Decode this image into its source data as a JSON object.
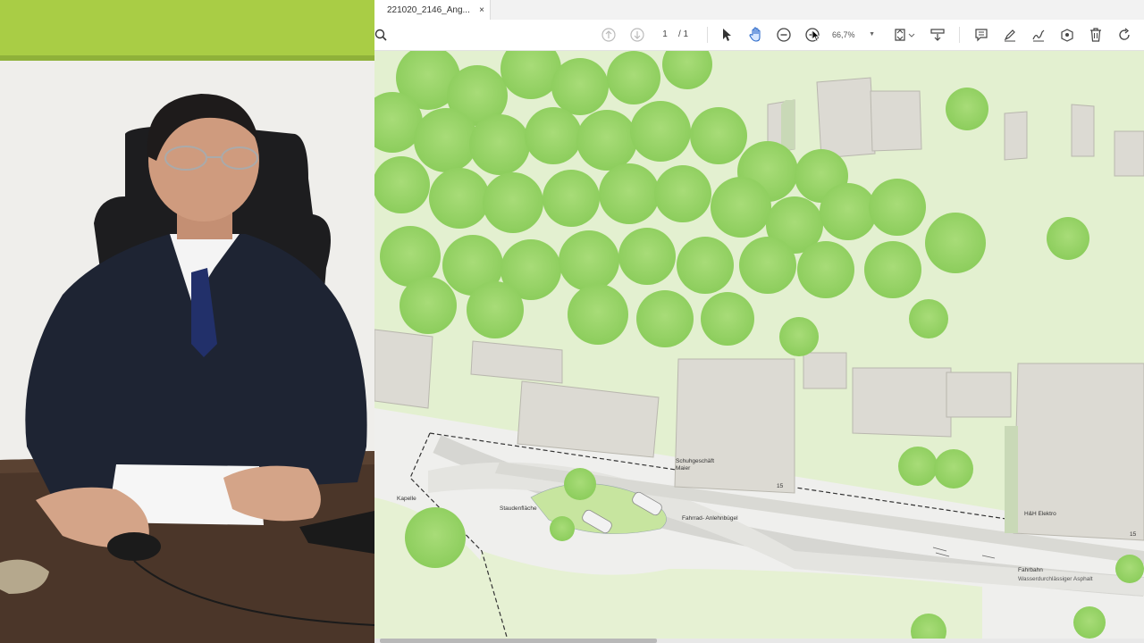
{
  "tab": {
    "title": "221020_2146_Ang...",
    "close": "×"
  },
  "toolbar": {
    "page_current": "1",
    "page_total": "/ 1",
    "zoom": "66,7%",
    "icons": [
      "search-icon",
      "page-up-icon",
      "page-down-icon",
      "select-arrow-icon",
      "hand-tool-icon",
      "zoom-out-icon",
      "zoom-in-icon",
      "fit-page-icon",
      "scroll-mode-icon",
      "comment-icon",
      "highlight-pen-icon",
      "sign-icon",
      "stamp-icon",
      "delete-icon",
      "rotate-icon"
    ]
  },
  "plan": {
    "labels": {
      "kapelle": "Kapelle",
      "staudenflaeche": "Staudenfläche",
      "fahrrad": "Fahrrad- Anlehnbügel",
      "schuhgeschaeft": "Schuhgeschäft\nMaier",
      "hh_elektro": "H&H Elektro",
      "fahrbahn": "Fahrbahn",
      "fahrbahn_sub": "Wasserdurchlässiger Asphalt",
      "num15a": "15",
      "num15b": "15"
    },
    "colors": {
      "grass": "#e1efcd",
      "tree": "#98d468",
      "building": "#dcdad3",
      "road": "#f1f1ef"
    }
  }
}
